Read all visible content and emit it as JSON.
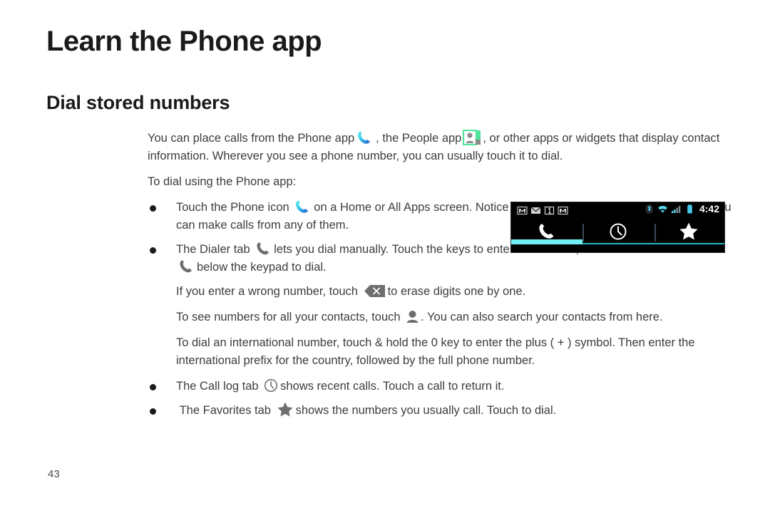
{
  "document": {
    "title": "Learn the Phone app",
    "section_heading": "Dial stored numbers",
    "page_number": "43"
  },
  "intro": {
    "p1_a": "You can place calls from the Phone app",
    "p1_b": ", the People app",
    "p1_c": ", or other apps or widgets that display contact information. Wherever you see a phone number, you can usually touch it to dial.",
    "p2": "To dial using the Phone app:"
  },
  "bullets": [
    {
      "id": "touch-phone-icon",
      "text_a": "Touch the Phone icon",
      "text_b": "on a Home or All Apps screen. Notice the three tabs at the top of the phone. You can make calls from any of them."
    },
    {
      "id": "dialer-tab",
      "text_a": "The Dialer tab",
      "text_b": "lets you dial manually. Touch the keys to enter the number, then touch the Phone icon",
      "text_c": "below the keypad to dial."
    },
    {
      "id": "call-log-tab",
      "text_a": "The Call log tab",
      "text_b": "shows recent calls. Touch a call to return it."
    },
    {
      "id": "favorites-tab",
      "text_a": "The Favorites tab",
      "text_b": "shows the numbers you usually call. Touch to dial."
    }
  ],
  "sub_paragraphs": {
    "backspace_a": "If you enter a wrong number, touch",
    "backspace_b": "to erase digits one by one.",
    "contacts_a": "To see numbers for all your contacts, touch",
    "contacts_b": ". You can also search your contacts from here.",
    "international": "To dial an international number, touch & hold the 0 key to enter the plus ( + ) symbol. Then enter the international prefix for the country, followed by the full phone number."
  },
  "phone_screenshot": {
    "status_bar": {
      "time": "4:42",
      "notification_icons": [
        "gmail-icon",
        "envelope-icon",
        "sms-count-icon",
        "gmail-icon"
      ],
      "system_icons": [
        "bluetooth-icon",
        "wifi-icon",
        "signal-icon",
        "battery-icon"
      ]
    },
    "tabs": [
      {
        "name": "dialer-tab",
        "icon": "phone-handset-icon",
        "active": true
      },
      {
        "name": "call-log-tab",
        "icon": "clock-icon",
        "active": false
      },
      {
        "name": "favorites-tab",
        "icon": "star-icon",
        "active": false
      }
    ],
    "colors": {
      "background": "#000000",
      "accent_active": "#6ff0f5",
      "accent_line": "#1fb8c9",
      "status_text": "#ffffff"
    }
  },
  "colors": {
    "heading": "#1a1a1a",
    "body_text": "#3d3d3d",
    "phone_icon_gradient_start": "#5de0e6",
    "phone_icon_gradient_end": "#2a5fd8",
    "people_icon_green": "#4ee39a",
    "gray_icon": "#6e6e6e"
  }
}
